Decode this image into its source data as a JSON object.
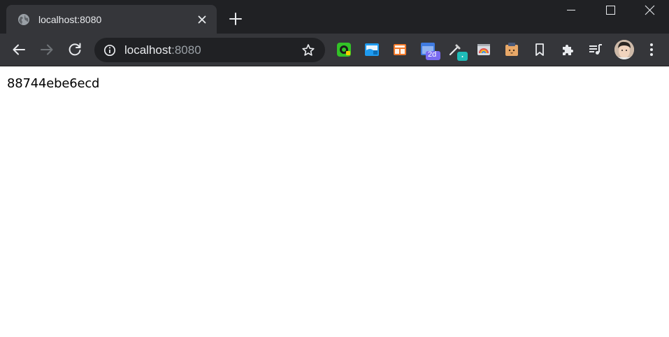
{
  "window": {
    "controls": {
      "minimize": "minimize-icon",
      "maximize": "maximize-icon",
      "close": "close-icon"
    }
  },
  "tab": {
    "title": "localhost:8080",
    "favicon": "globe-icon",
    "close_icon": "close-icon"
  },
  "new_tab_icon": "plus-icon",
  "toolbar": {
    "back_icon": "arrow-left-icon",
    "forward_icon": "arrow-right-icon",
    "reload_icon": "reload-icon",
    "address": {
      "host": "localhost",
      "port": ":8080",
      "info_icon": "info-icon",
      "bookmark_icon": "star-icon"
    },
    "extensions": [
      "camera-extension-icon",
      "window-extension-icon",
      "layout-extension-icon",
      "calendar-extension-icon",
      "eyedropper-extension-icon",
      "rainbow-window-extension-icon",
      "box-face-extension-icon",
      "bookmark-icon",
      "puzzle-icon",
      "media-queue-icon"
    ],
    "calendar_badge": "2d",
    "profile": "avatar",
    "menu_icon": "vertical-dots-icon"
  },
  "colors": {
    "frame": "#202124",
    "toolbar": "#35363a",
    "text_light": "#e8eaed",
    "text_muted": "#9aa0a6"
  },
  "page": {
    "text": "88744ebe6ecd"
  }
}
